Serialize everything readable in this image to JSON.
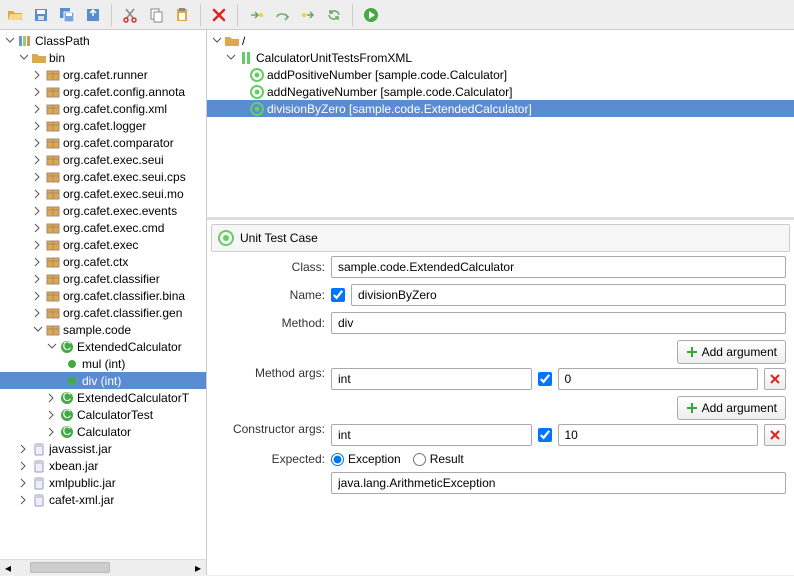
{
  "toolbar": {
    "buttons": [
      {
        "name": "open-icon",
        "title": "Open"
      },
      {
        "name": "save-icon",
        "title": "Save"
      },
      {
        "name": "save-all-icon",
        "title": "Save All"
      },
      {
        "name": "export-icon",
        "title": "Export"
      }
    ],
    "edit_buttons": [
      {
        "name": "cut-icon",
        "title": "Cut"
      },
      {
        "name": "copy-icon",
        "title": "Copy"
      },
      {
        "name": "paste-icon",
        "title": "Paste"
      }
    ],
    "delete_button": {
      "name": "delete-icon",
      "title": "Delete"
    },
    "nav_buttons": [
      {
        "name": "step-into-icon",
        "title": "Step"
      },
      {
        "name": "step-over-icon",
        "title": "Step Over"
      },
      {
        "name": "step-out-icon",
        "title": "Step Out"
      },
      {
        "name": "sync-icon",
        "title": "Sync"
      }
    ],
    "run_button": {
      "name": "run-icon",
      "title": "Run"
    }
  },
  "left_tree": {
    "root": "ClassPath",
    "bin": "bin",
    "packages": [
      "org.cafet.runner",
      "org.cafet.config.annota",
      "org.cafet.config.xml",
      "org.cafet.logger",
      "org.cafet.comparator",
      "org.cafet.exec.seui",
      "org.cafet.exec.seui.cps",
      "org.cafet.exec.seui.mo",
      "org.cafet.exec.events",
      "org.cafet.exec.cmd",
      "org.cafet.exec",
      "org.cafet.ctx",
      "org.cafet.classifier",
      "org.cafet.classifier.bina",
      "org.cafet.classifier.gen"
    ],
    "sample_pkg": "sample.code",
    "ext_calc": "ExtendedCalculator",
    "mul": "mul (int)",
    "div": "div (int)",
    "ext_calc_t": "ExtendedCalculatorT",
    "calc_test": "CalculatorTest",
    "calc": "Calculator",
    "jars": [
      "javassist.jar",
      "xbean.jar",
      "xmlpublic.jar",
      "cafet-xml.jar"
    ]
  },
  "right_tree": {
    "root": "/",
    "suite": "CalculatorUnitTestsFromXML",
    "tests": [
      {
        "label": "addPositiveNumber",
        "cls": "[sample.code.Calculator]"
      },
      {
        "label": "addNegativeNumber",
        "cls": "[sample.code.Calculator]"
      },
      {
        "label": "divisionByZero",
        "cls": "[sample.code.ExtendedCalculator]",
        "selected": true
      }
    ]
  },
  "panel": {
    "title": "Unit Test Case",
    "labels": {
      "class": "Class:",
      "name": "Name:",
      "method": "Method:",
      "method_args": "Method args:",
      "constructor_args": "Constructor args:",
      "expected": "Expected:"
    },
    "class_value": "sample.code.ExtendedCalculator",
    "name_value": "divisionByZero",
    "name_checked": true,
    "method_value": "div",
    "add_argument": "Add argument",
    "method_args": [
      {
        "type": "int",
        "checked": true,
        "value": "0"
      }
    ],
    "constructor_args": [
      {
        "type": "int",
        "checked": true,
        "value": "10"
      }
    ],
    "expected": {
      "exception": "Exception",
      "result": "Result",
      "selected": "exception"
    },
    "expected_value": "java.lang.ArithmeticException"
  }
}
